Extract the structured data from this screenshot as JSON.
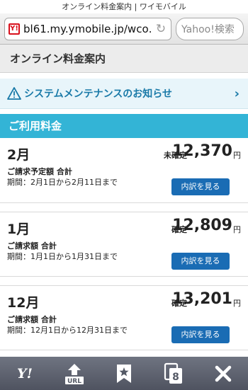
{
  "browser": {
    "title": "オンライン料金案内 | ワイモバイル",
    "url": "bl61.my.ymobile.jp/wco…",
    "search_placeholder": "Yahoo!検索"
  },
  "page": {
    "header": "オンライン料金案内",
    "notice": "システムメンテナンスのお知らせ",
    "section_title": "ご利用料金"
  },
  "bills": [
    {
      "month": "2月",
      "status": "未確定",
      "amount": "12,370",
      "unit": "円",
      "label": "ご請求予定額 合計",
      "period": "期間：2月1日から2月11日まで",
      "button": "内訳を見る"
    },
    {
      "month": "1月",
      "status": "確定",
      "amount": "12,809",
      "unit": "円",
      "label": "ご請求額 合計",
      "period": "期間：1月1日から1月31日まで",
      "button": "内訳を見る"
    },
    {
      "month": "12月",
      "status": "確定",
      "amount": "13,201",
      "unit": "円",
      "label": "ご請求額 合計",
      "period": "期間：12月1日から12月31日まで",
      "button": "内訳を見る"
    }
  ],
  "toolbar": {
    "yahoo": "Y!",
    "url_label": "URL",
    "tabs_count": "8",
    "icons": [
      "yahoo-icon",
      "url-icon",
      "bookmark-icon",
      "tabs-icon",
      "close-icon"
    ]
  },
  "colors": {
    "accent": "#33b4d6",
    "button": "#1a6cb4",
    "notice_text": "#1a7aa8",
    "toolbar": "#5c606c"
  }
}
